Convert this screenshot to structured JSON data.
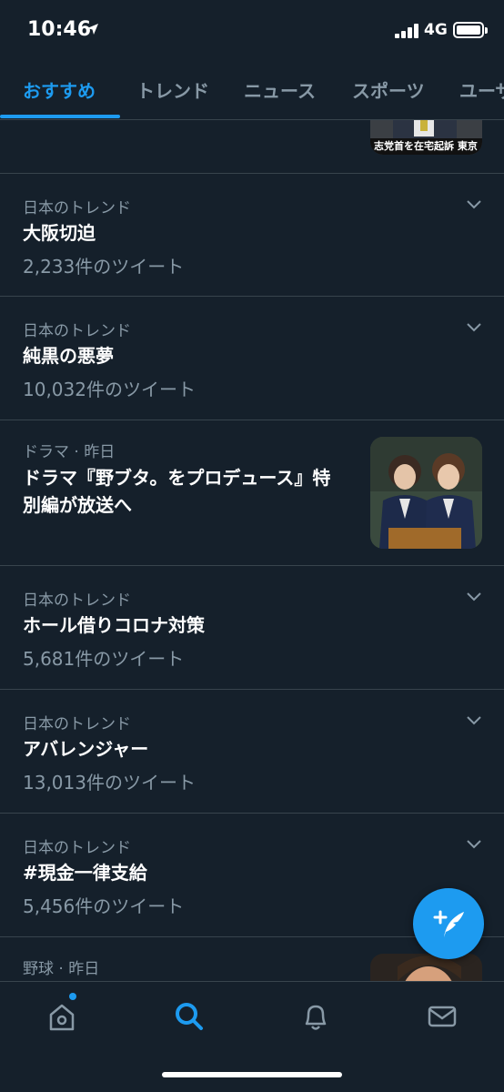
{
  "status": {
    "time": "10:46",
    "network": "4G"
  },
  "tabs": [
    {
      "label": "おすすめ",
      "active": true
    },
    {
      "label": "トレンド",
      "active": false
    },
    {
      "label": "ニュース",
      "active": false
    },
    {
      "label": "スポーツ",
      "active": false
    },
    {
      "label": "ユーザー",
      "active": false
    }
  ],
  "top_item": {
    "thumb_caption": "志党首を在宅起訴 東京"
  },
  "feed": [
    {
      "meta": "日本のトレンド",
      "title": "大阪切迫",
      "count": "2,233件のツイート"
    },
    {
      "meta": "日本のトレンド",
      "title": "純黒の悪夢",
      "count": "10,032件のツイート"
    },
    {
      "meta": "ドラマ · 昨日",
      "title_line1": "ドラマ『野ブタ。をプロデュース』特",
      "title_line2": "別編が放送へ"
    },
    {
      "meta": "日本のトレンド",
      "title": "ホール借りコロナ対策",
      "count": "5,681件のツイート"
    },
    {
      "meta": "日本のトレンド",
      "title": "アバレンジャー",
      "count": "13,013件のツイート"
    },
    {
      "meta": "日本のトレンド",
      "title": "#現金一律支給",
      "count": "5,456件のツイート"
    },
    {
      "meta": "野球 · 昨日"
    }
  ],
  "colors": {
    "background": "#15202b",
    "accent": "#1d9bf0",
    "muted_text": "#8899a6",
    "divider": "#38444d"
  },
  "icons": {
    "location": "location-arrow-icon",
    "chevron": "chevron-down-icon",
    "compose": "compose-tweet-icon",
    "home": "home-icon",
    "search": "search-icon",
    "notifications": "bell-icon",
    "messages": "mail-icon"
  }
}
